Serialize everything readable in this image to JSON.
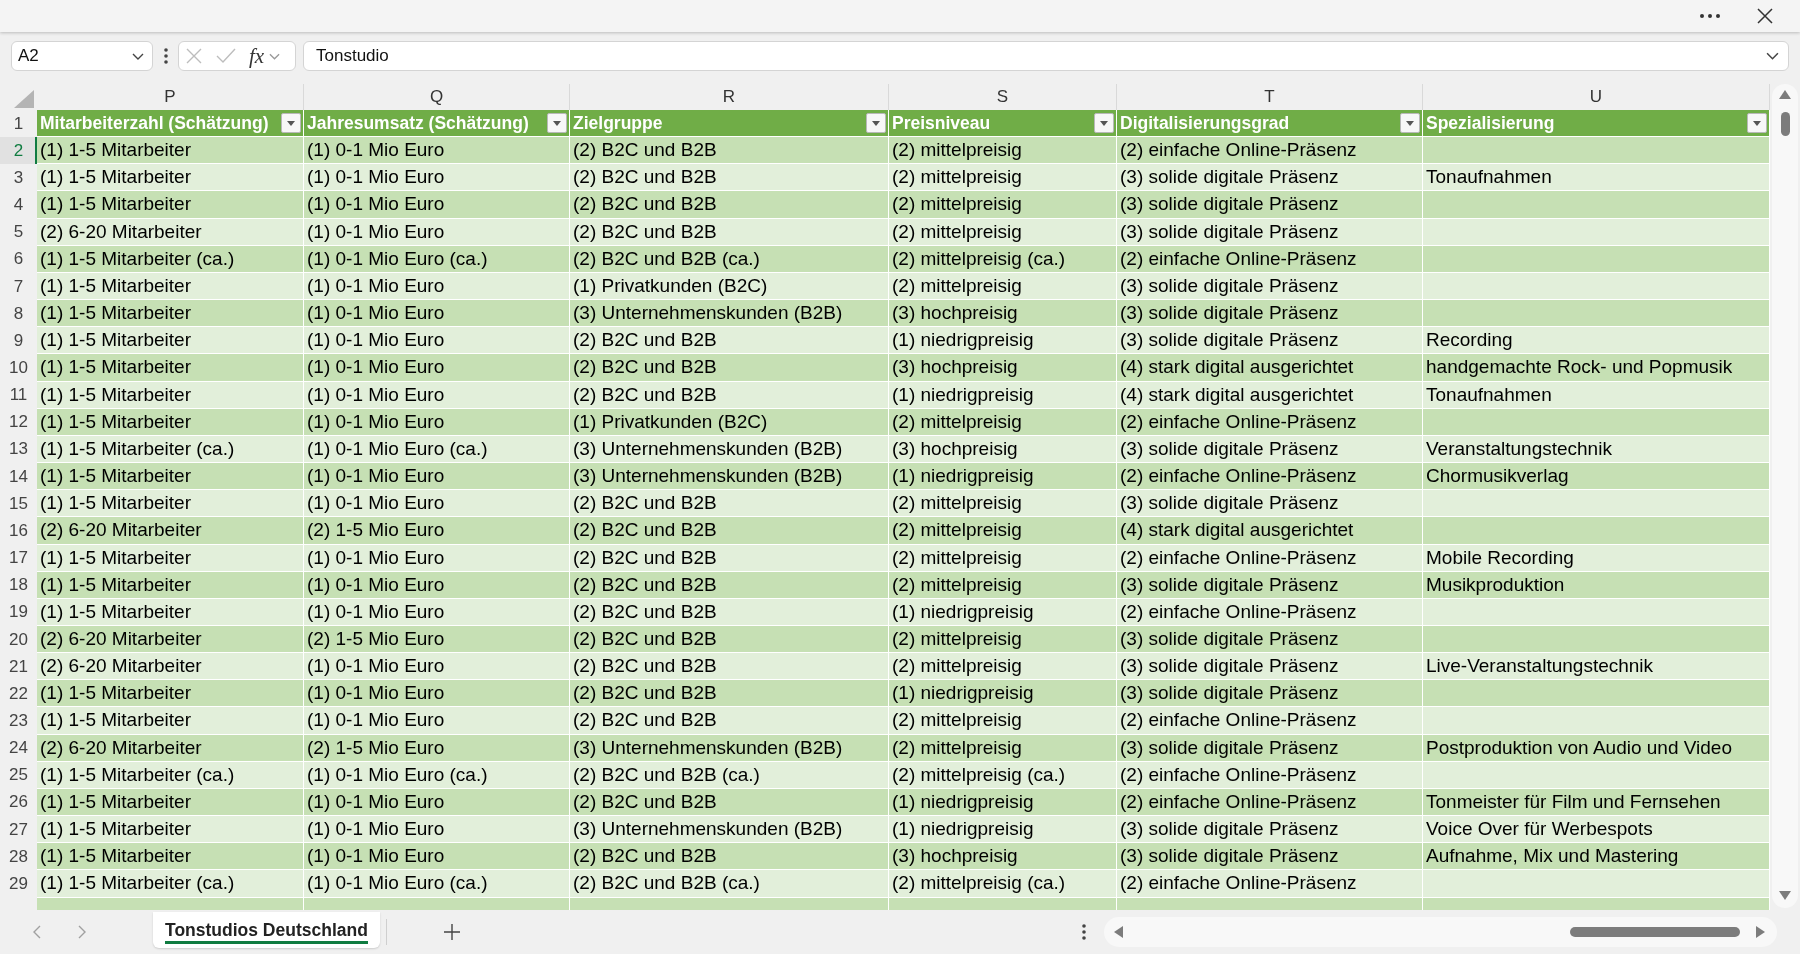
{
  "formula_bar": {
    "name_box": "A2",
    "function_label": "fx",
    "formula": "Tonstudio"
  },
  "table": {
    "header_row_number": "1",
    "columns": [
      {
        "letter": "P",
        "title": "Mitarbeiterzahl (Schätzung)"
      },
      {
        "letter": "Q",
        "title": "Jahresumsatz (Schätzung)"
      },
      {
        "letter": "R",
        "title": "Zielgruppe"
      },
      {
        "letter": "S",
        "title": "Preisniveau"
      },
      {
        "letter": "T",
        "title": "Digitalisierungsgrad"
      },
      {
        "letter": "U",
        "title": "Spezialisierung"
      }
    ],
    "rows": [
      {
        "number": "2",
        "selected": true,
        "cells": [
          "(1) 1-5 Mitarbeiter",
          "(1) 0-1 Mio Euro",
          "(2) B2C und B2B",
          "(2) mittelpreisig",
          "(2) einfache Online-Präsenz",
          null
        ]
      },
      {
        "number": "3",
        "selected": false,
        "cells": [
          "(1) 1-5 Mitarbeiter",
          "(1) 0-1 Mio Euro",
          "(2) B2C und B2B",
          "(2) mittelpreisig",
          "(3) solide digitale Präsenz",
          "Tonaufnahmen"
        ]
      },
      {
        "number": "4",
        "selected": false,
        "cells": [
          "(1) 1-5 Mitarbeiter",
          "(1) 0-1 Mio Euro",
          "(2) B2C und B2B",
          "(2) mittelpreisig",
          "(3) solide digitale Präsenz",
          null
        ]
      },
      {
        "number": "5",
        "selected": false,
        "cells": [
          "(2) 6-20 Mitarbeiter",
          "(1) 0-1 Mio Euro",
          "(2) B2C und B2B",
          "(2) mittelpreisig",
          "(3) solide digitale Präsenz",
          null
        ]
      },
      {
        "number": "6",
        "selected": false,
        "cells": [
          "(1) 1-5 Mitarbeiter (ca.)",
          "(1) 0-1 Mio Euro (ca.)",
          "(2) B2C und B2B (ca.)",
          "(2) mittelpreisig (ca.)",
          "(2) einfache Online-Präsenz",
          null
        ]
      },
      {
        "number": "7",
        "selected": false,
        "cells": [
          "(1) 1-5 Mitarbeiter",
          "(1) 0-1 Mio Euro",
          "(1) Privatkunden (B2C)",
          "(2) mittelpreisig",
          "(3) solide digitale Präsenz",
          null
        ]
      },
      {
        "number": "8",
        "selected": false,
        "cells": [
          "(1) 1-5 Mitarbeiter",
          "(1) 0-1 Mio Euro",
          "(3) Unternehmenskunden (B2B)",
          "(3) hochpreisig",
          "(3) solide digitale Präsenz",
          null
        ]
      },
      {
        "number": "9",
        "selected": false,
        "cells": [
          "(1) 1-5 Mitarbeiter",
          "(1) 0-1 Mio Euro",
          "(2) B2C und B2B",
          "(1) niedrigpreisig",
          "(3) solide digitale Präsenz",
          "Recording"
        ]
      },
      {
        "number": "10",
        "selected": false,
        "cells": [
          "(1) 1-5 Mitarbeiter",
          "(1) 0-1 Mio Euro",
          "(2) B2C und B2B",
          "(3) hochpreisig",
          "(4) stark digital ausgerichtet",
          "handgemachte Rock- und Popmusik"
        ]
      },
      {
        "number": "11",
        "selected": false,
        "cells": [
          "(1) 1-5 Mitarbeiter",
          "(1) 0-1 Mio Euro",
          "(2) B2C und B2B",
          "(1) niedrigpreisig",
          "(4) stark digital ausgerichtet",
          "Tonaufnahmen"
        ]
      },
      {
        "number": "12",
        "selected": false,
        "cells": [
          "(1) 1-5 Mitarbeiter",
          "(1) 0-1 Mio Euro",
          "(1) Privatkunden (B2C)",
          "(2) mittelpreisig",
          "(2) einfache Online-Präsenz",
          null
        ]
      },
      {
        "number": "13",
        "selected": false,
        "cells": [
          "(1) 1-5 Mitarbeiter (ca.)",
          "(1) 0-1 Mio Euro (ca.)",
          "(3) Unternehmenskunden (B2B)",
          "(3) hochpreisig",
          "(3) solide digitale Präsenz",
          "Veranstaltungstechnik"
        ]
      },
      {
        "number": "14",
        "selected": false,
        "cells": [
          "(1) 1-5 Mitarbeiter",
          "(1) 0-1 Mio Euro",
          "(3) Unternehmenskunden (B2B)",
          "(1) niedrigpreisig",
          "(2) einfache Online-Präsenz",
          "Chormusikverlag"
        ]
      },
      {
        "number": "15",
        "selected": false,
        "cells": [
          "(1) 1-5 Mitarbeiter",
          "(1) 0-1 Mio Euro",
          "(2) B2C und B2B",
          "(2) mittelpreisig",
          "(3) solide digitale Präsenz",
          null
        ]
      },
      {
        "number": "16",
        "selected": false,
        "cells": [
          "(2) 6-20 Mitarbeiter",
          "(2) 1-5 Mio Euro",
          "(2) B2C und B2B",
          "(2) mittelpreisig",
          "(4) stark digital ausgerichtet",
          null
        ]
      },
      {
        "number": "17",
        "selected": false,
        "cells": [
          "(1) 1-5 Mitarbeiter",
          "(1) 0-1 Mio Euro",
          "(2) B2C und B2B",
          "(2) mittelpreisig",
          "(2) einfache Online-Präsenz",
          "Mobile Recording"
        ]
      },
      {
        "number": "18",
        "selected": false,
        "cells": [
          "(1) 1-5 Mitarbeiter",
          "(1) 0-1 Mio Euro",
          "(2) B2C und B2B",
          "(2) mittelpreisig",
          "(3) solide digitale Präsenz",
          "Musikproduktion"
        ]
      },
      {
        "number": "19",
        "selected": false,
        "cells": [
          "(1) 1-5 Mitarbeiter",
          "(1) 0-1 Mio Euro",
          "(2) B2C und B2B",
          "(1) niedrigpreisig",
          "(2) einfache Online-Präsenz",
          null
        ]
      },
      {
        "number": "20",
        "selected": false,
        "cells": [
          "(2) 6-20 Mitarbeiter",
          "(2) 1-5 Mio Euro",
          "(2) B2C und B2B",
          "(2) mittelpreisig",
          "(3) solide digitale Präsenz",
          null
        ]
      },
      {
        "number": "21",
        "selected": false,
        "cells": [
          "(2) 6-20 Mitarbeiter",
          "(1) 0-1 Mio Euro",
          "(2) B2C und B2B",
          "(2) mittelpreisig",
          "(3) solide digitale Präsenz",
          "Live-Veranstaltungstechnik"
        ]
      },
      {
        "number": "22",
        "selected": false,
        "cells": [
          "(1) 1-5 Mitarbeiter",
          "(1) 0-1 Mio Euro",
          "(2) B2C und B2B",
          "(1) niedrigpreisig",
          "(3) solide digitale Präsenz",
          null
        ]
      },
      {
        "number": "23",
        "selected": false,
        "cells": [
          "(1) 1-5 Mitarbeiter",
          "(1) 0-1 Mio Euro",
          "(2) B2C und B2B",
          "(2) mittelpreisig",
          "(2) einfache Online-Präsenz",
          null
        ]
      },
      {
        "number": "24",
        "selected": false,
        "cells": [
          "(2) 6-20 Mitarbeiter",
          "(2) 1-5 Mio Euro",
          "(3) Unternehmenskunden (B2B)",
          "(2) mittelpreisig",
          "(3) solide digitale Präsenz",
          "Postproduktion von Audio und Video"
        ]
      },
      {
        "number": "25",
        "selected": false,
        "cells": [
          "(1) 1-5 Mitarbeiter (ca.)",
          "(1) 0-1 Mio Euro (ca.)",
          "(2) B2C und B2B (ca.)",
          "(2) mittelpreisig (ca.)",
          "(2) einfache Online-Präsenz",
          null
        ]
      },
      {
        "number": "26",
        "selected": false,
        "cells": [
          "(1) 1-5 Mitarbeiter",
          "(1) 0-1 Mio Euro",
          "(2) B2C und B2B",
          "(1) niedrigpreisig",
          "(2) einfache Online-Präsenz",
          "Tonmeister für Film und Fernsehen"
        ]
      },
      {
        "number": "27",
        "selected": false,
        "cells": [
          "(1) 1-5 Mitarbeiter",
          "(1) 0-1 Mio Euro",
          "(3) Unternehmenskunden (B2B)",
          "(1) niedrigpreisig",
          "(3) solide digitale Präsenz",
          "Voice Over für Werbespots"
        ]
      },
      {
        "number": "28",
        "selected": false,
        "cells": [
          "(1) 1-5 Mitarbeiter",
          "(1) 0-1 Mio Euro",
          "(2) B2C und B2B",
          "(3) hochpreisig",
          "(3) solide digitale Präsenz",
          "Aufnahme, Mix und Mastering"
        ]
      },
      {
        "number": "29",
        "selected": false,
        "cells": [
          "(1) 1-5 Mitarbeiter (ca.)",
          "(1) 0-1 Mio Euro (ca.)",
          "(2) B2C und B2B (ca.)",
          "(2) mittelpreisig (ca.)",
          "(2) einfache Online-Präsenz",
          null
        ]
      }
    ]
  },
  "sheet_tabs": [
    {
      "label": "Tonstudios Deutschland",
      "selected": true
    }
  ]
}
